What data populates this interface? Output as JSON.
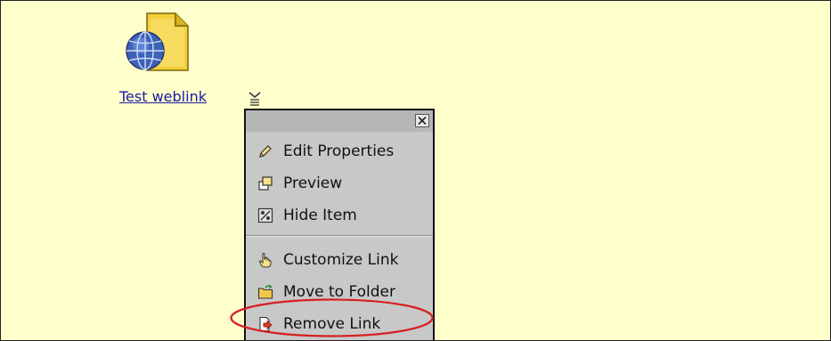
{
  "item": {
    "name": "Test weblink",
    "icon": "weblink-file-icon"
  },
  "menu": {
    "close_icon": "close-icon",
    "groups": [
      [
        {
          "label": "Edit Properties",
          "icon": "pencil-icon"
        },
        {
          "label": "Preview",
          "icon": "preview-window-icon"
        },
        {
          "label": "Hide Item",
          "icon": "hide-item-icon"
        }
      ],
      [
        {
          "label": "Customize Link",
          "icon": "hand-pointer-icon"
        },
        {
          "label": "Move to Folder",
          "icon": "move-folder-icon"
        },
        {
          "label": "Remove Link",
          "icon": "remove-link-icon"
        }
      ]
    ]
  },
  "colors": {
    "page_background": "#ffffcc",
    "menu_background": "#c8c8c8",
    "link": "#1a1aa6",
    "highlight": "#d62020"
  }
}
